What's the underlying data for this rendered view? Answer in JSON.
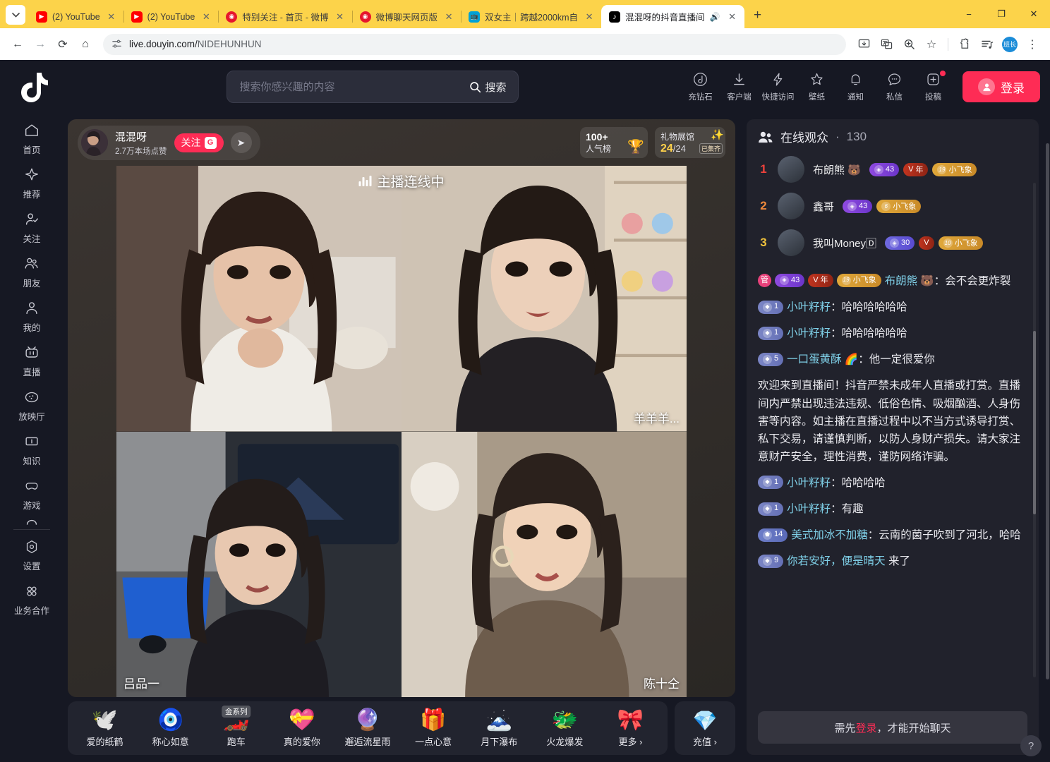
{
  "browser": {
    "tabs": [
      {
        "title": "(2) YouTube",
        "favicon": "youtube-icon",
        "active": false,
        "audio": false
      },
      {
        "title": "(2) YouTube",
        "favicon": "youtube-icon",
        "active": false,
        "audio": false
      },
      {
        "title": "特别关注 - 首页 - 微博",
        "favicon": "weibo-icon",
        "active": false,
        "audio": false
      },
      {
        "title": "微博聊天网页版",
        "favicon": "weibo-icon",
        "active": false,
        "audio": false
      },
      {
        "title": "双女主｜跨越2000km自",
        "favicon": "bilibili-icon",
        "active": false,
        "audio": false
      },
      {
        "title": "混混呀的抖音直播间",
        "favicon": "douyin-icon",
        "active": true,
        "audio": true
      }
    ],
    "tab_close_label": "✕",
    "new_tab_label": "+",
    "window_controls": {
      "minimize": "−",
      "maximize": "❐",
      "close": "✕"
    },
    "nav": {
      "back": "←",
      "forward": "→",
      "reload": "⟳",
      "home": "⌂"
    },
    "url_prefix": "live.douyin.com/",
    "url_path": "NIDEHUNHUN",
    "extension_badge": "班长",
    "menu_label": "⋮"
  },
  "header": {
    "logo": "douyin-logo",
    "search": {
      "value": "",
      "placeholder": "搜索你感兴趣的内容",
      "button_label": "搜索"
    },
    "icons": [
      {
        "name": "充钻石",
        "icon": "diamond-recharge-icon",
        "dot": false
      },
      {
        "name": "客户端",
        "icon": "download-icon",
        "dot": false
      },
      {
        "name": "快捷访问",
        "icon": "lightning-icon",
        "dot": false
      },
      {
        "name": "壁纸",
        "icon": "wallpaper-star-icon",
        "dot": false
      },
      {
        "name": "通知",
        "icon": "bell-icon",
        "dot": false
      },
      {
        "name": "私信",
        "icon": "message-icon",
        "dot": false
      },
      {
        "name": "投稿",
        "icon": "upload-plus-icon",
        "dot": true
      }
    ],
    "login_label": "登录"
  },
  "sidebar": {
    "items": [
      {
        "label": "首页",
        "icon": "home-icon"
      },
      {
        "label": "推荐",
        "icon": "sparkle-icon"
      },
      {
        "label": "关注",
        "icon": "user-check-icon"
      },
      {
        "label": "朋友",
        "icon": "friends-icon"
      },
      {
        "label": "我的",
        "icon": "person-icon"
      },
      {
        "label": "直播",
        "icon": "live-tv-icon"
      },
      {
        "label": "放映厅",
        "icon": "cinema-icon"
      },
      {
        "label": "知识",
        "icon": "knowledge-icon"
      },
      {
        "label": "游戏",
        "icon": "gamepad-icon"
      }
    ],
    "footer": [
      {
        "label": "设置",
        "icon": "settings-icon"
      },
      {
        "label": "业务合作",
        "icon": "grid-dots-icon"
      }
    ]
  },
  "stream": {
    "anchor": {
      "name": "混混呀",
      "stats": "2.7万本场点赞",
      "follow_label": "关注",
      "follow_badge": "G",
      "share_icon": "share-icon"
    },
    "popularity": {
      "value": "100+",
      "label": "人气榜",
      "icon": "trophy-icon"
    },
    "gift_hall": {
      "label": "礼物展馆",
      "count": "24",
      "total": "/24",
      "status": "已集齐",
      "icon": "star-crown-icon"
    },
    "live_badge": {
      "label": "主播连线中",
      "icon": "audio-bars-icon"
    },
    "cells": [
      {
        "tag": "",
        "pos": "right"
      },
      {
        "tag": "羊羊羊...",
        "pos": "right"
      },
      {
        "tag": "吕品一",
        "pos": "left"
      },
      {
        "tag": "陈十仝",
        "pos": "right"
      }
    ],
    "gifts": [
      {
        "label": "爱的纸鹤",
        "emoji": "🕊️",
        "badge": ""
      },
      {
        "label": "称心如意",
        "emoji": "🧿",
        "badge": ""
      },
      {
        "label": "跑车",
        "emoji": "🏎️",
        "badge": "金系列"
      },
      {
        "label": "真的爱你",
        "emoji": "💝",
        "badge": ""
      },
      {
        "label": "邂逅流星雨",
        "emoji": "🔮",
        "badge": ""
      },
      {
        "label": "一点心意",
        "emoji": "🎁",
        "badge": ""
      },
      {
        "label": "月下瀑布",
        "emoji": "🗻",
        "badge": ""
      },
      {
        "label": "火龙爆发",
        "emoji": "🐲",
        "badge": ""
      },
      {
        "label": "更多 ›",
        "emoji": "🎀",
        "badge": ""
      }
    ],
    "recharge": {
      "label": "充值 ›",
      "emoji": "💎"
    }
  },
  "chat": {
    "viewers_title": "在线观众",
    "viewers_sep": "·",
    "viewers_count": "130",
    "viewers_icon": "people-icon",
    "top_viewers": [
      {
        "rank": "1",
        "name": "布朗熊 🐻",
        "badges": [
          {
            "type": "fan",
            "text": "43",
            "icon": "fan-club-icon"
          },
          {
            "type": "v",
            "text": "年",
            "icon": "v-icon"
          },
          {
            "type": "gold",
            "text": "小飞象",
            "icon": "19"
          }
        ]
      },
      {
        "rank": "2",
        "name": "鑫哥",
        "badges": [
          {
            "type": "fan",
            "text": "43",
            "icon": "fan-club-icon"
          },
          {
            "type": "gold",
            "text": "小飞象",
            "icon": "6"
          }
        ]
      },
      {
        "rank": "3",
        "name": "我叫Money🄳",
        "badges": [
          {
            "type": "fan30",
            "text": "30",
            "icon": "fan-club-icon"
          },
          {
            "type": "v",
            "text": "",
            "icon": "v-icon"
          },
          {
            "type": "gold",
            "text": "小飞象",
            "icon": "10"
          }
        ]
      }
    ],
    "messages": [
      {
        "kind": "user",
        "badges": [
          {
            "type": "admin",
            "text": "管"
          },
          {
            "type": "fan",
            "text": "43"
          },
          {
            "type": "v",
            "text": "年"
          },
          {
            "type": "gold",
            "text": "小飞象",
            "icon": "19"
          }
        ],
        "user": "布朗熊 🐻",
        "sep": "：",
        "text": "会不会更炸裂"
      },
      {
        "kind": "user",
        "badges": [
          {
            "type": "lvl",
            "text": "1"
          }
        ],
        "user": "小叶籽籽",
        "sep": "：",
        "text": "哈哈哈哈哈哈"
      },
      {
        "kind": "user",
        "badges": [
          {
            "type": "lvl",
            "text": "1"
          }
        ],
        "user": "小叶籽籽",
        "sep": "：",
        "text": "哈哈哈哈哈哈"
      },
      {
        "kind": "user",
        "badges": [
          {
            "type": "lvl",
            "text": "5"
          }
        ],
        "user": "一口蛋黄酥 🌈",
        "sep": "：",
        "text": "他一定很爱你"
      },
      {
        "kind": "system",
        "text": "欢迎来到直播间！抖音严禁未成年人直播或打赏。直播间内严禁出现违法违规、低俗色情、吸烟酗酒、人身伤害等内容。如主播在直播过程中以不当方式诱导打赏、私下交易，请谨慎判断，以防人身财产损失。请大家注意财产安全，理性消费，谨防网络诈骗。"
      },
      {
        "kind": "user",
        "badges": [
          {
            "type": "lvl",
            "text": "1"
          }
        ],
        "user": "小叶籽籽",
        "sep": "：",
        "text": "哈哈哈哈"
      },
      {
        "kind": "user",
        "badges": [
          {
            "type": "lvl",
            "text": "1"
          }
        ],
        "user": "小叶籽籽",
        "sep": "：",
        "text": "有趣"
      },
      {
        "kind": "user",
        "badges": [
          {
            "type": "lvl14",
            "text": "14"
          }
        ],
        "user": "美式加冰不加糖",
        "sep": "：",
        "text": "云南的菌子吹到了河北，哈哈"
      },
      {
        "kind": "user",
        "badges": [
          {
            "type": "lvl",
            "text": "9"
          }
        ],
        "user": "你若安好，便是晴天",
        "sep": " ",
        "text": "来了"
      }
    ],
    "login_prompt_pre": "需先",
    "login_prompt_link": "登录",
    "login_prompt_post": "，才能开始聊天",
    "help_label": "?"
  },
  "colors": {
    "accent": "#fe2c55",
    "page_bg": "#161823",
    "panel_bg": "#21222c",
    "system_msg": "#f0a93b",
    "username": "#7fd0e8",
    "tabstrip": "#fcd34a"
  }
}
